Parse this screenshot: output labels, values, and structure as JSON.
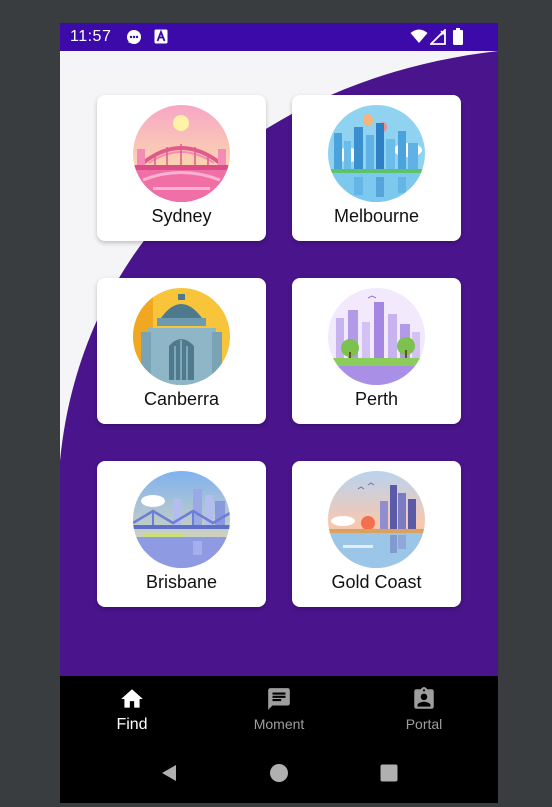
{
  "status_bar": {
    "time": "11:57",
    "icons": [
      "chat-notification-icon",
      "keyboard-a-icon",
      "wifi-icon",
      "signal-icon",
      "battery-icon"
    ]
  },
  "cities": [
    {
      "name": "Sydney",
      "icon": "sydney-harbour-bridge-illustration"
    },
    {
      "name": "Melbourne",
      "icon": "melbourne-skyline-illustration"
    },
    {
      "name": "Canberra",
      "icon": "canberra-war-memorial-illustration"
    },
    {
      "name": "Perth",
      "icon": "perth-skyline-illustration"
    },
    {
      "name": "Brisbane",
      "icon": "brisbane-story-bridge-illustration"
    },
    {
      "name": "Gold Coast",
      "icon": "gold-coast-skyline-illustration"
    }
  ],
  "bottom_nav": {
    "items": [
      {
        "label": "Find",
        "icon": "home-icon",
        "active": true
      },
      {
        "label": "Moment",
        "icon": "message-icon",
        "active": false
      },
      {
        "label": "Portal",
        "icon": "contact-badge-icon",
        "active": false
      }
    ]
  },
  "system_nav": {
    "buttons": [
      "back-icon",
      "home-circle-icon",
      "recents-icon"
    ]
  },
  "colors": {
    "primary": "#3b0aa8",
    "background_curve": "#4a148c",
    "nav_background": "#000000",
    "card": "#ffffff"
  }
}
